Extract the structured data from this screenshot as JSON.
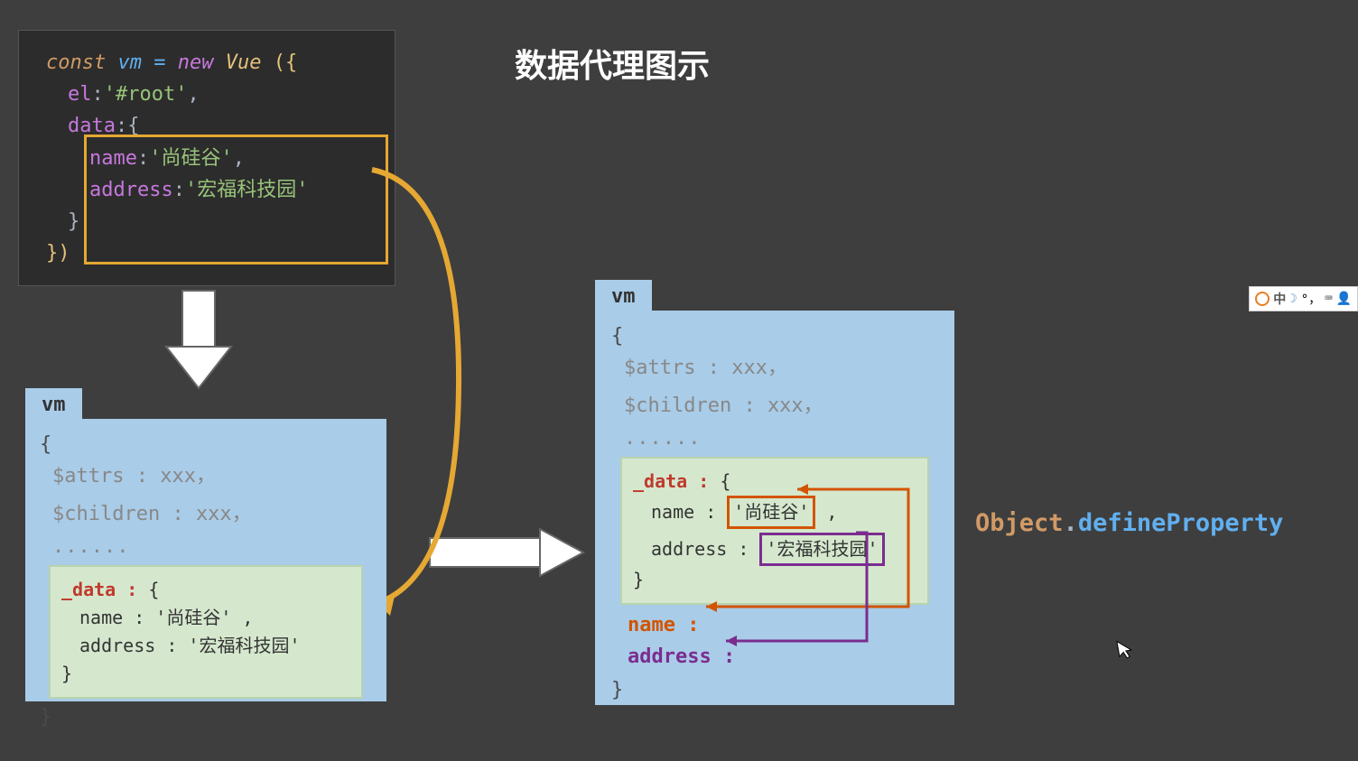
{
  "title": "数据代理图示",
  "code": {
    "const": "const",
    "vmVar": "vm",
    "eq": "=",
    "new": "new",
    "vueClass": "Vue",
    "openParenBrace": "({",
    "el_key": "el",
    "el_val": "'#root'",
    "data_key": "data",
    "data_open": ":{",
    "name_key": "name",
    "name_val": "'尚硅谷'",
    "addr_key": "address",
    "addr_val": "'宏福科技园'",
    "data_close": "}",
    "closeBraceParen": "})"
  },
  "vm1": {
    "tab": "vm",
    "brace_open": "{",
    "attrs": "$attrs : xxx，",
    "children": "$children : xxx，",
    "dots": "......",
    "data": {
      "key": "_data :",
      "open": " {",
      "name_line": "name : '尚硅谷' ,",
      "addr_line": "address : '宏福科技园'",
      "close": "}"
    },
    "brace_close": "}"
  },
  "vm2": {
    "tab": "vm",
    "brace_open": "{",
    "attrs": "$attrs : xxx，",
    "children": "$children : xxx，",
    "dots": "......",
    "data": {
      "key": "_data :",
      "open": " {",
      "name_label": "name : ",
      "name_val": "'尚硅谷'",
      "name_comma": " ,",
      "addr_label": "address : ",
      "addr_val": "'宏福科技园'",
      "close": "}"
    },
    "proxy_name": "name :",
    "proxy_addr": "address :",
    "brace_close": "}"
  },
  "objDefine": {
    "obj": "Object",
    "dot": ".",
    "method": "defineProperty"
  },
  "ime": {
    "zh": "中",
    "comma": "°，"
  }
}
